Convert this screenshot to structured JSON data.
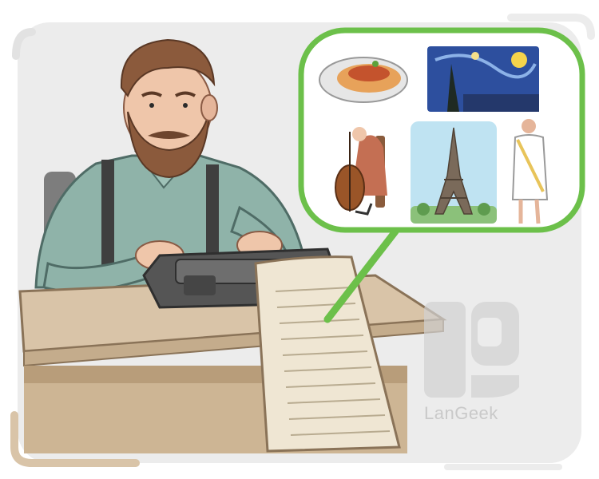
{
  "illustration": {
    "subject": "man-typing-on-stenotype",
    "thought_bubble_items": [
      "spaghetti",
      "starry-night-painting",
      "cellist",
      "eiffel-tower",
      "toga"
    ]
  },
  "watermark": {
    "brand": "LanGeek",
    "icon": "langeek-logo-icon"
  },
  "colors": {
    "background_panel": "#ececec",
    "bubble_border": "#6cc04a",
    "desk": "#d9c4a8",
    "shirt": "#8fb3a9",
    "paper": "#efe6d3"
  }
}
